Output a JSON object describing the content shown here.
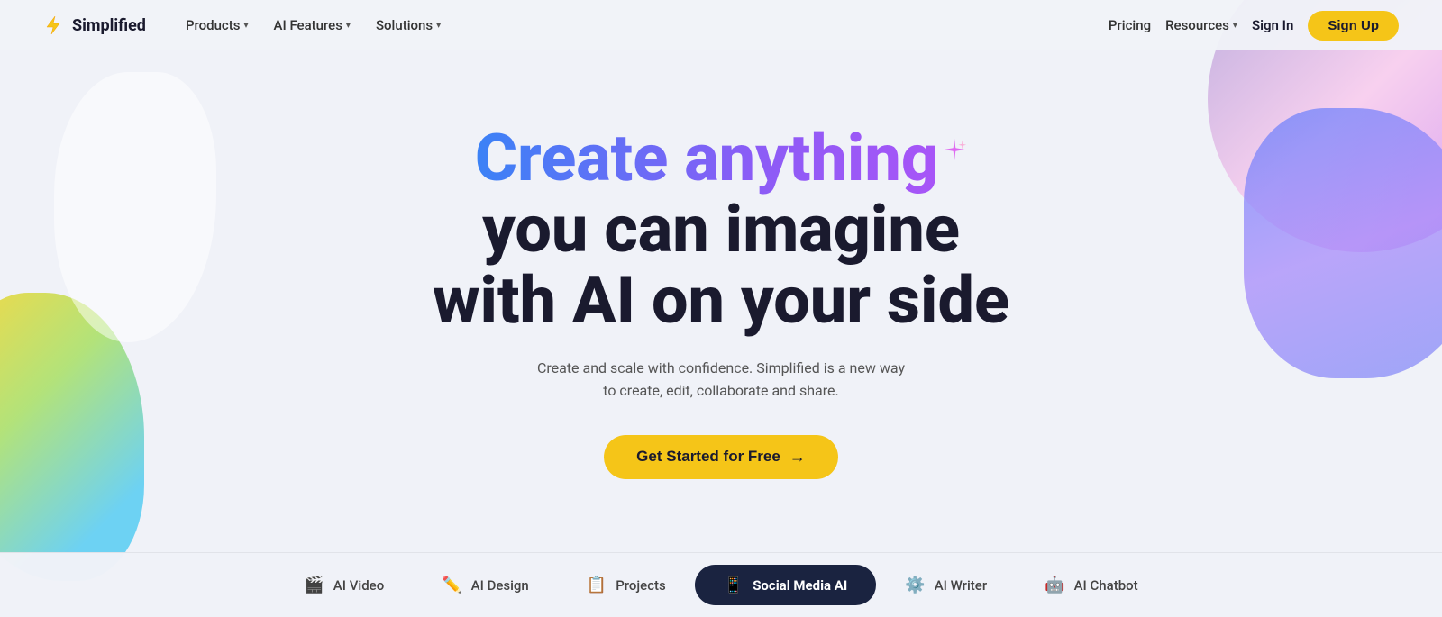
{
  "brand": {
    "name": "Simplified",
    "logo_icon": "⚡"
  },
  "navbar": {
    "nav_items": [
      {
        "label": "Products",
        "has_dropdown": true
      },
      {
        "label": "AI Features",
        "has_dropdown": true
      },
      {
        "label": "Solutions",
        "has_dropdown": true
      }
    ],
    "nav_right": [
      {
        "label": "Pricing",
        "has_dropdown": false
      },
      {
        "label": "Resources",
        "has_dropdown": true
      }
    ],
    "sign_in_label": "Sign In",
    "sign_up_label": "Sign Up"
  },
  "hero": {
    "title_gradient": "Create anything",
    "title_rest_line1": "you can imagine",
    "title_rest_line2": "with AI on your side",
    "subtitle": "Create and scale with confidence. Simplified is a new way\nto create, edit, collaborate and share.",
    "cta_label": "Get Started for Free",
    "cta_arrow": "→"
  },
  "features": [
    {
      "icon": "🎬",
      "label": "AI Video",
      "active": false
    },
    {
      "icon": "✏️",
      "label": "AI Design",
      "active": false
    },
    {
      "icon": "📋",
      "label": "Projects",
      "active": false
    },
    {
      "icon": "📱",
      "label": "Social Media AI",
      "active": true
    },
    {
      "icon": "⚙️",
      "label": "AI Writer",
      "active": false
    },
    {
      "icon": "🤖",
      "label": "AI Chatbot",
      "active": false
    }
  ]
}
